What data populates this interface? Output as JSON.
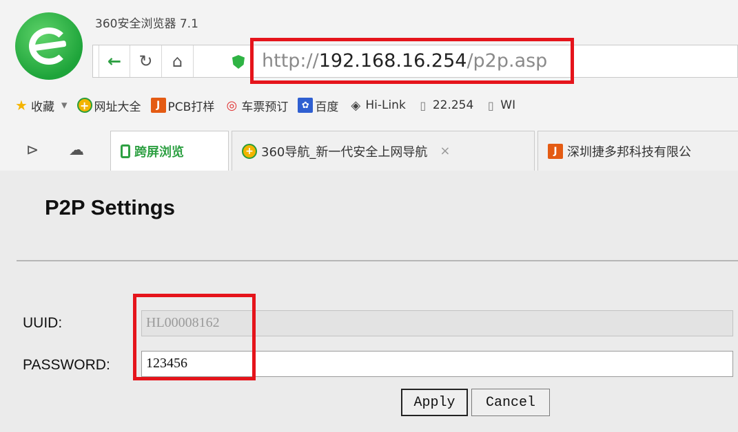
{
  "browser": {
    "title": "360安全浏览器 7.1",
    "url": {
      "scheme": "http://",
      "host": "192.168.16.254",
      "path": "/p2p.asp"
    }
  },
  "bookmarks": [
    {
      "icon": "star-icon",
      "label": "收藏",
      "dropdown": "▾"
    },
    {
      "icon": "plus-circle-icon",
      "label": "网址大全"
    },
    {
      "icon": "jdb-logo-icon",
      "label": "PCB打样"
    },
    {
      "icon": "target-icon",
      "label": "车票预订"
    },
    {
      "icon": "paw-icon",
      "label": "百度"
    },
    {
      "icon": "hilink-diamond-icon",
      "label": "Hi-Link"
    },
    {
      "icon": "document-icon",
      "label": "22.254"
    },
    {
      "icon": "document-icon",
      "label": "WI"
    }
  ],
  "tabs": [
    {
      "label": "跨屏浏览",
      "active": true
    },
    {
      "label": "360导航_新一代安全上网导航",
      "close": "×"
    },
    {
      "label": "深圳捷多邦科技有限公"
    }
  ],
  "page": {
    "title": "P2P Settings",
    "uuid_label": "UUID:",
    "uuid_value": "HL00008162",
    "password_label": "PASSWORD:",
    "password_value": "123456",
    "apply": "Apply",
    "cancel": "Cancel"
  },
  "colors": {
    "highlight": "#e5141b",
    "brand_green": "#2ea043"
  }
}
